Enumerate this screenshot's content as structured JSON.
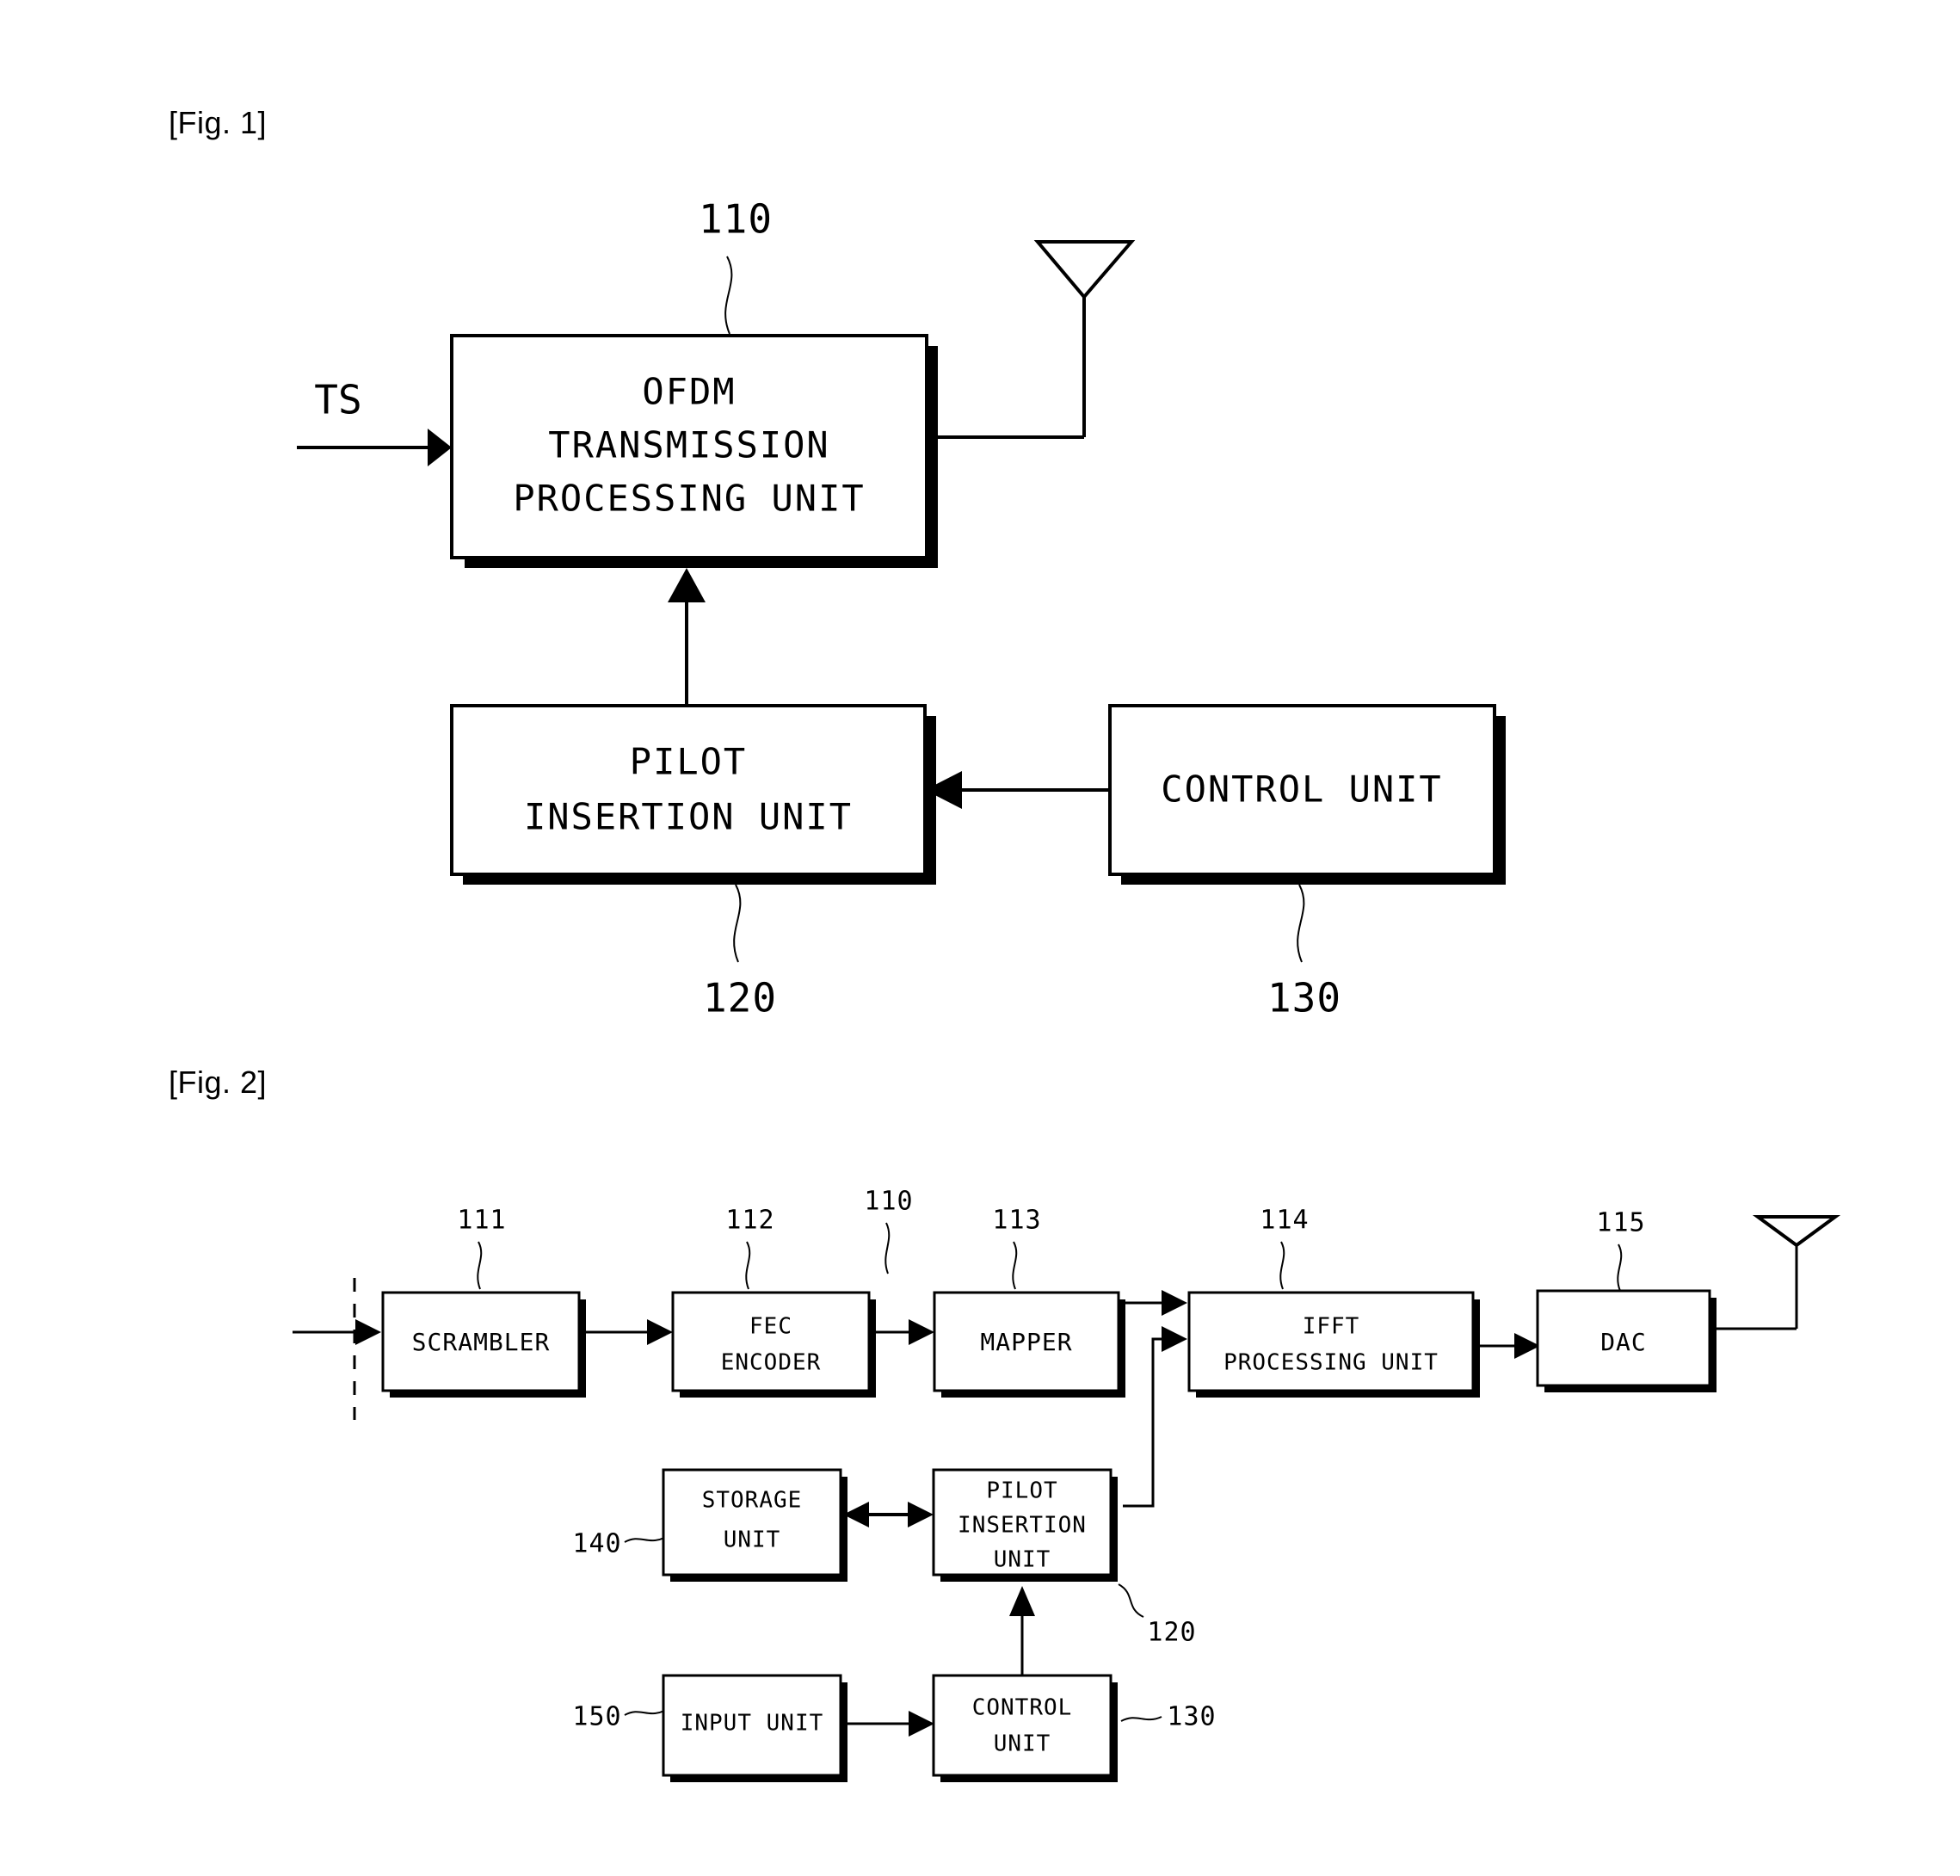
{
  "document": {
    "type": "patent-drawing-sheet",
    "background_color": "#ffffff",
    "ink_color": "#000000"
  },
  "figures": [
    {
      "id": "fig1",
      "caption": "[Fig. 1]",
      "blocks": [
        {
          "id": "ofdm",
          "label_lines": [
            "OFDM",
            "TRANSMISSION",
            "PROCESSING UNIT"
          ],
          "ref": "110"
        },
        {
          "id": "pilot",
          "label_lines": [
            "PILOT",
            "INSERTION UNIT"
          ],
          "ref": "120"
        },
        {
          "id": "control",
          "label_lines": [
            "CONTROL UNIT"
          ],
          "ref": "130"
        }
      ],
      "signals": [
        {
          "id": "ts-input",
          "label": "TS"
        }
      ],
      "icons": [
        {
          "id": "antenna",
          "name": "antenna-icon"
        }
      ]
    },
    {
      "id": "fig2",
      "caption": "[Fig. 2]",
      "blocks": [
        {
          "id": "scrambler",
          "label_lines": [
            "SCRAMBLER"
          ],
          "ref": "111"
        },
        {
          "id": "fec",
          "label_lines": [
            "FEC",
            "ENCODER"
          ],
          "ref": "112"
        },
        {
          "id": "mapper",
          "label_lines": [
            "MAPPER"
          ],
          "ref": "113"
        },
        {
          "id": "ifft",
          "label_lines": [
            "IFFT",
            "PROCESSING UNIT"
          ],
          "ref": "114"
        },
        {
          "id": "dac",
          "label_lines": [
            "DAC"
          ],
          "ref": "115"
        },
        {
          "id": "storage",
          "label_lines": [
            "STORAGE",
            "UNIT"
          ],
          "ref": "140"
        },
        {
          "id": "pilot2",
          "label_lines": [
            "PILOT",
            "INSERTION",
            "UNIT"
          ],
          "ref": "120"
        },
        {
          "id": "input",
          "label_lines": [
            "INPUT UNIT"
          ],
          "ref": "150"
        },
        {
          "id": "control2",
          "label_lines": [
            "CONTROL",
            "UNIT"
          ],
          "ref": "130"
        }
      ],
      "group_ref": "110",
      "icons": [
        {
          "id": "antenna2",
          "name": "antenna-icon"
        }
      ]
    }
  ],
  "fig1": {
    "caption": "[Fig. 1]",
    "ts_label": "TS",
    "ofdm_line1": "OFDM",
    "ofdm_line2": "TRANSMISSION",
    "ofdm_line3": "PROCESSING UNIT",
    "ofdm_ref": "110",
    "pilot_line1": "PILOT",
    "pilot_line2": "INSERTION UNIT",
    "pilot_ref": "120",
    "control_line1": "CONTROL UNIT",
    "control_ref": "130"
  },
  "fig2": {
    "caption": "[Fig. 2]",
    "scrambler_label": "SCRAMBLER",
    "scrambler_ref": "111",
    "fec_line1": "FEC",
    "fec_line2": "ENCODER",
    "fec_ref": "112",
    "group_ref": "110",
    "mapper_label": "MAPPER",
    "mapper_ref": "113",
    "ifft_line1": "IFFT",
    "ifft_line2": "PROCESSING UNIT",
    "ifft_ref": "114",
    "dac_label": "DAC",
    "dac_ref": "115",
    "storage_line1": "STORAGE",
    "storage_line2": "UNIT",
    "storage_ref": "140",
    "pilot_line1": "PILOT",
    "pilot_line2": "INSERTION",
    "pilot_line3": "UNIT",
    "pilot_ref": "120",
    "input_label": "INPUT UNIT",
    "input_ref": "150",
    "control_line1": "CONTROL",
    "control_line2": "UNIT",
    "control_ref": "130"
  }
}
